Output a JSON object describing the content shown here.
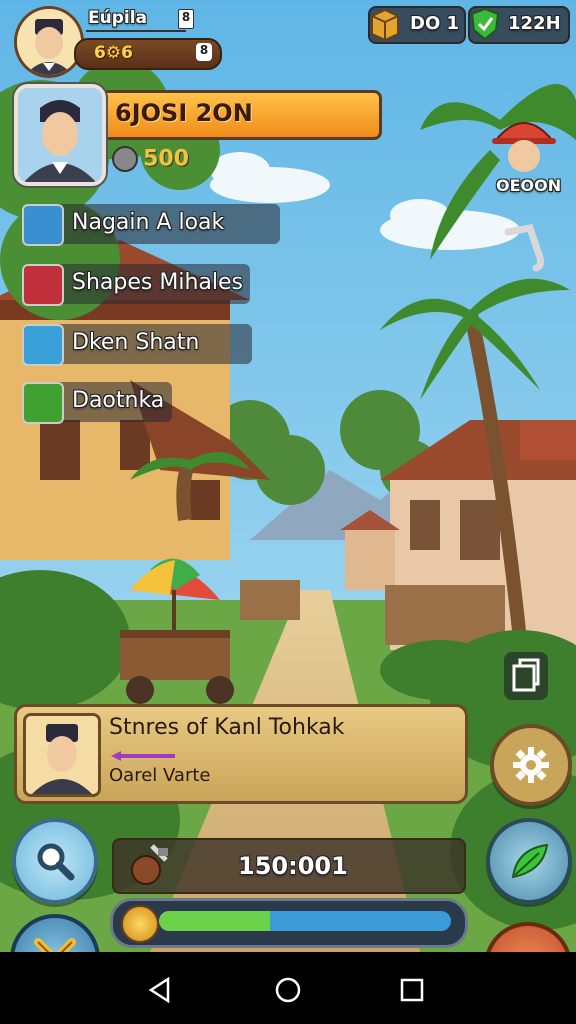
{
  "player": {
    "name": "Eúpila",
    "rank_badge": "8",
    "level_text": "6⚙6",
    "level_badge": "8"
  },
  "currencies": {
    "gold": "DO 1",
    "gems": "122H"
  },
  "quest_banner": {
    "title": "6JOSI 2ON",
    "sub_value": "500"
  },
  "npc": {
    "name": "OEOON"
  },
  "skills": [
    {
      "label": "Nagain A loak",
      "icon": "brush-icon",
      "color": "#3a8fd0"
    },
    {
      "label": "Shapes Mihales",
      "icon": "hammer-icon",
      "color": "#c0303a"
    },
    {
      "label": "Dken Shatn",
      "icon": "scroll-icon",
      "color": "#3aa0d8"
    },
    {
      "label": "Daotnka",
      "icon": "bread-icon",
      "color": "#40a030"
    }
  ],
  "dialogue": {
    "title": "Stnres of Kanl Tohkak",
    "speaker": "Oarel Varte"
  },
  "resource": {
    "value": "150:001"
  },
  "progress": {
    "fraction": 0.38
  },
  "colors": {
    "banner_orange": "#f3a02a",
    "panel_tan": "#d9b870",
    "progress_green": "#6cd24a",
    "progress_blue": "#3b9bd6"
  }
}
